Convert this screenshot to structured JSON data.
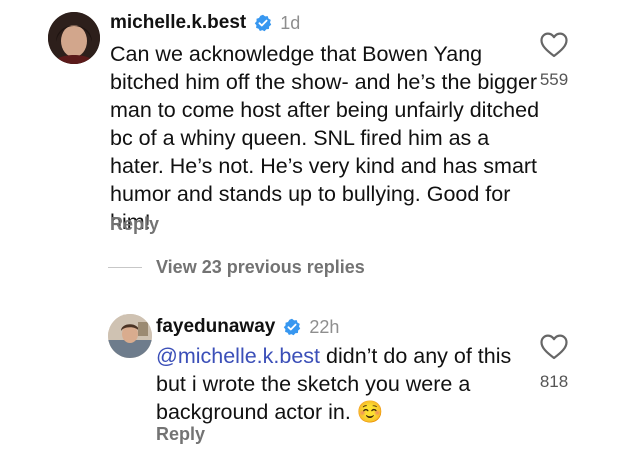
{
  "comment": {
    "username": "michelle.k.best",
    "time": "1d",
    "text": "Can we acknowledge that Bowen Yang bitched him off the show- and he’s the bigger man to come host after being unfairly ditched bc of a whiny queen.  SNL fired him as a hater. He’s not. He’s very kind and has smart humor and stands up to bullying. Good for him!",
    "reply_label": "Reply",
    "likes": "559"
  },
  "view_replies": {
    "label": "View 23 previous replies"
  },
  "reply": {
    "username": "fayedunaway",
    "time": "22h",
    "mention": "@michelle.k.best",
    "text": " didn’t do any of this but i wrote the sketch you were a background actor in. ",
    "emoji": "☺️",
    "reply_label": "Reply",
    "likes": "818"
  },
  "colors": {
    "verified": "#3797f0",
    "mention": "#3b4fb8",
    "secondary_text": "#737373"
  },
  "icons": {
    "like": "heart-outline-icon",
    "verified": "verified-badge-icon"
  }
}
